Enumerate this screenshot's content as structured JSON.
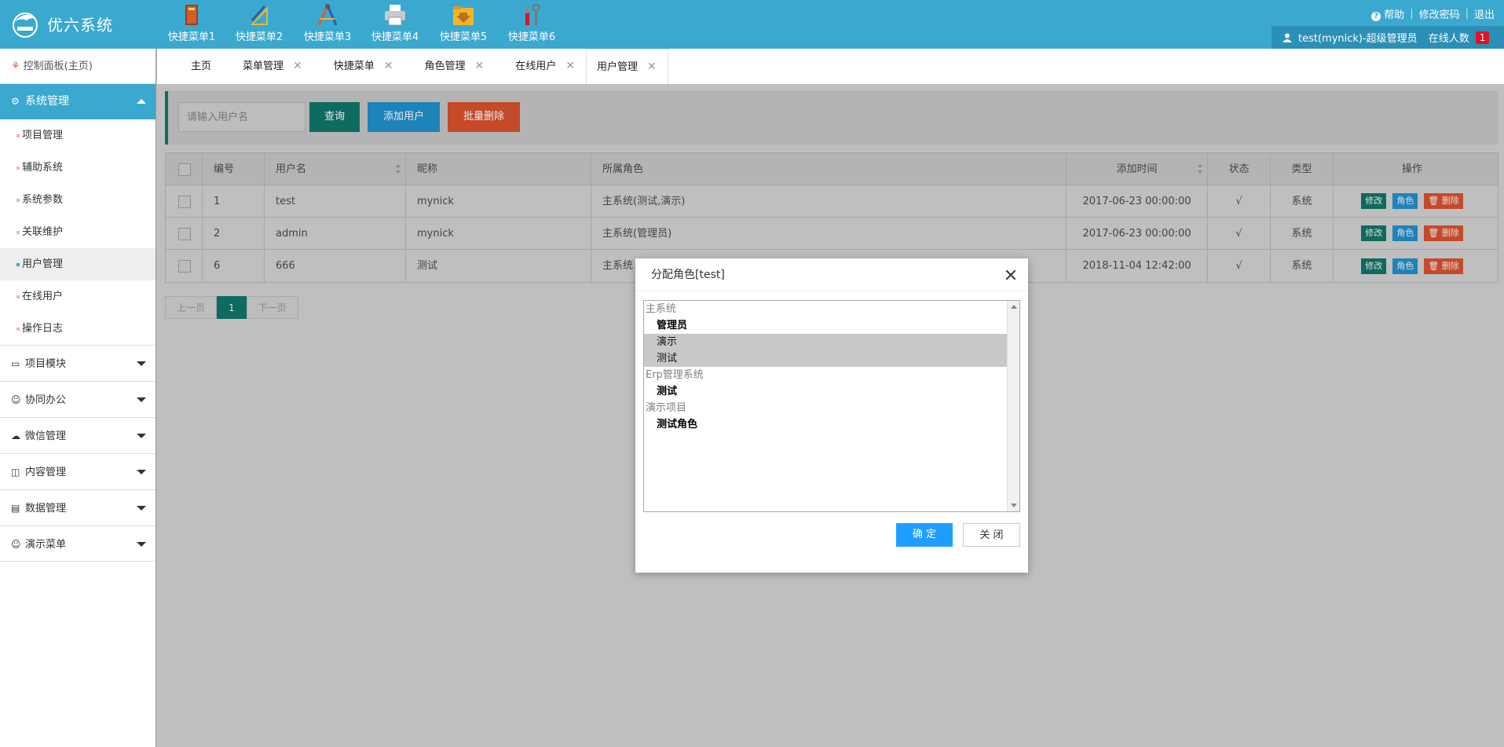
{
  "app": {
    "title": "优六系统"
  },
  "quick_menu": [
    {
      "label": "快捷菜单1",
      "icon": "book-icon"
    },
    {
      "label": "快捷菜单2",
      "icon": "ruler-pencil-icon"
    },
    {
      "label": "快捷菜单3",
      "icon": "compass-icon"
    },
    {
      "label": "快捷菜单4",
      "icon": "printer-icon"
    },
    {
      "label": "快捷菜单5",
      "icon": "download-folder-icon"
    },
    {
      "label": "快捷菜单6",
      "icon": "tools-icon"
    }
  ],
  "top_links": {
    "help": "帮助",
    "change_password": "修改密码",
    "logout": "退出"
  },
  "user_bar": {
    "user": "test(mynick)-超级管理员",
    "online_label": "在线人数",
    "online_count": "1"
  },
  "sidebar": {
    "dashboard": "控制面板(主页)",
    "active_group": "系统管理",
    "sub_items": [
      "项目管理",
      "辅助系统",
      "系统参数",
      "关联维护",
      "用户管理",
      "在线用户",
      "操作日志"
    ],
    "active_sub": "用户管理",
    "groups": [
      "项目模块",
      "协同办公",
      "微信管理",
      "内容管理",
      "数据管理",
      "演示菜单"
    ]
  },
  "tabs": [
    {
      "label": "主页",
      "closable": false
    },
    {
      "label": "菜单管理",
      "closable": true
    },
    {
      "label": "快捷菜单",
      "closable": true
    },
    {
      "label": "角色管理",
      "closable": true
    },
    {
      "label": "在线用户",
      "closable": true
    },
    {
      "label": "用户管理",
      "closable": true,
      "active": true
    }
  ],
  "toolbar": {
    "search_placeholder": "请输入用户名",
    "query": "查询",
    "add_user": "添加用户",
    "batch_delete": "批量删除"
  },
  "table": {
    "headers": {
      "id": "编号",
      "username": "用户名",
      "nickname": "昵称",
      "roles": "所属角色",
      "added_time": "添加时间",
      "status": "状态",
      "type": "类型",
      "ops": "操作"
    },
    "rows": [
      {
        "id": "1",
        "username": "test",
        "nickname": "mynick",
        "roles": "主系统(测试,演示)",
        "added_time": "2017-06-23 00:00:00",
        "status": "√",
        "type": "系统"
      },
      {
        "id": "2",
        "username": "admin",
        "nickname": "mynick",
        "roles": "主系统(管理员)",
        "added_time": "2017-06-23 00:00:00",
        "status": "√",
        "type": "系统"
      },
      {
        "id": "6",
        "username": "666",
        "nickname": "测试",
        "roles": "主系统",
        "added_time": "2018-11-04 12:42:00",
        "status": "√",
        "type": "系统"
      }
    ],
    "ops": {
      "edit": "修改",
      "role": "角色",
      "delete": "删除"
    }
  },
  "pager": {
    "prev": "上一页",
    "current": "1",
    "next": "下一页"
  },
  "modal": {
    "title": "分配角色[test]",
    "groups": [
      {
        "label": "主系统",
        "options": [
          {
            "label": "管理员",
            "selected": false
          },
          {
            "label": "演示",
            "selected": true
          },
          {
            "label": "测试",
            "selected": true
          }
        ]
      },
      {
        "label": "Erp管理系统",
        "options": [
          {
            "label": "测试",
            "selected": false
          }
        ]
      },
      {
        "label": "演示项目",
        "options": [
          {
            "label": "测试角色",
            "selected": false
          }
        ]
      }
    ],
    "ok": "确 定",
    "cancel": "关 闭"
  },
  "colors": {
    "primary": "#3aa8cf",
    "user_bar": "#2b90b7",
    "badge": "#e1121f",
    "green": "#0d6b5f",
    "blue": "#1e83b9",
    "red": "#c54a2a",
    "modal_ok": "#1e9fff"
  }
}
